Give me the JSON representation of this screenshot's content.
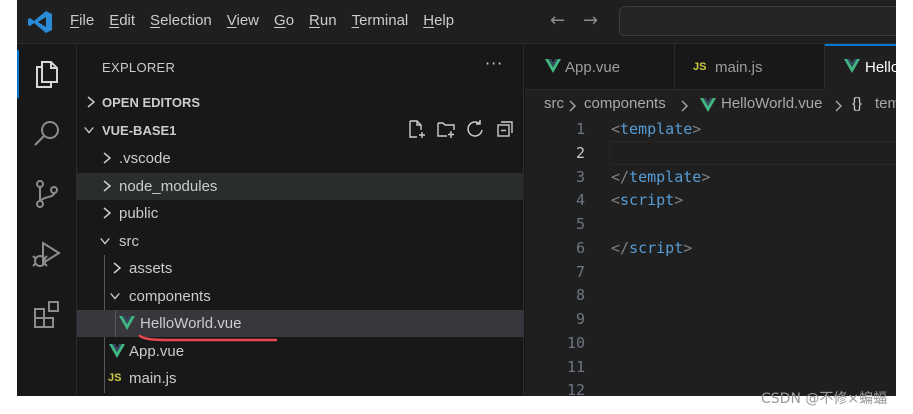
{
  "menu": [
    {
      "key": "F",
      "rest": "ile"
    },
    {
      "key": "E",
      "rest": "dit"
    },
    {
      "key": "S",
      "rest": "election"
    },
    {
      "key": "V",
      "rest": "iew"
    },
    {
      "key": "G",
      "rest": "o"
    },
    {
      "key": "R",
      "rest": "un"
    },
    {
      "key": "T",
      "rest": "erminal"
    },
    {
      "key": "H",
      "rest": "elp"
    }
  ],
  "nav": {
    "back": "←",
    "forward": "→"
  },
  "explorer": {
    "title": "EXPLORER",
    "more": "···",
    "open_editors": "OPEN EDITORS",
    "project": "VUE-BASE1",
    "tree": {
      "vscode": ".vscode",
      "node_modules": "node_modules",
      "public": "public",
      "src": "src",
      "assets": "assets",
      "components": "components",
      "helloworld": "HelloWorld.vue",
      "app": "App.vue",
      "main": "main.js"
    }
  },
  "tabs": {
    "app": "App.vue",
    "main": "main.js",
    "hello": "HelloWorld.vue",
    "js_badge": "JS"
  },
  "breadcrumb": {
    "src": "src",
    "components": "components",
    "file": "HelloWorld.vue",
    "symbol_icon": "{}",
    "symbol": "template"
  },
  "code": {
    "line_numbers": [
      "1",
      "2",
      "3",
      "4",
      "5",
      "6",
      "7",
      "8",
      "9",
      "10",
      "11",
      "12"
    ],
    "current_line": 2,
    "l1_open": "<",
    "l1_tag": "template",
    "l1_close": ">",
    "l3_open": "</",
    "l3_tag": "template",
    "l3_close": ">",
    "l4_open": "<",
    "l4_tag": "script",
    "l4_close": ">",
    "l6_open": "</",
    "l6_tag": "script",
    "l6_close": ">"
  },
  "colors": {
    "vue_green": "#41b883",
    "vue_dark": "#35495e",
    "js_yellow": "#cbcb41",
    "accent_blue": "#0078d4",
    "annotation_red": "#e8474e"
  },
  "watermark": "CSDN @不修×蝙蝠"
}
